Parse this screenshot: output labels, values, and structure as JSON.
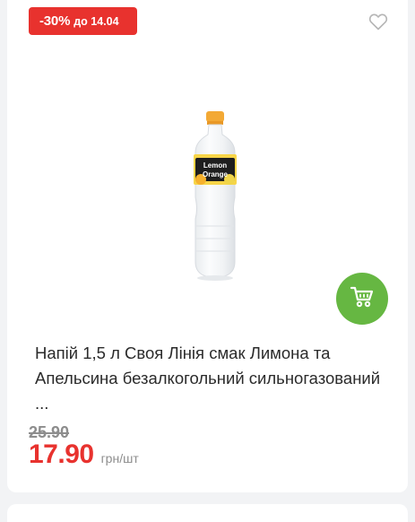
{
  "badge": {
    "discount": "-30%",
    "until": "до 14.04"
  },
  "product": {
    "bottle_label_line1": "Lemon",
    "bottle_label_line2": "Orange",
    "title": "Напій 1,5 л Своя Лінія смак Лимона та Апельсина безалкогольний сильногазований ...",
    "old_price": "25.90",
    "price": "17.90",
    "unit": "грн/шт"
  },
  "icons": {
    "favorite": "heart-outline-icon",
    "cart": "shopping-cart-icon"
  },
  "colors": {
    "discount_red": "#e8322e",
    "cart_green": "#66b742",
    "old_price_gray": "#8d8d8d"
  }
}
